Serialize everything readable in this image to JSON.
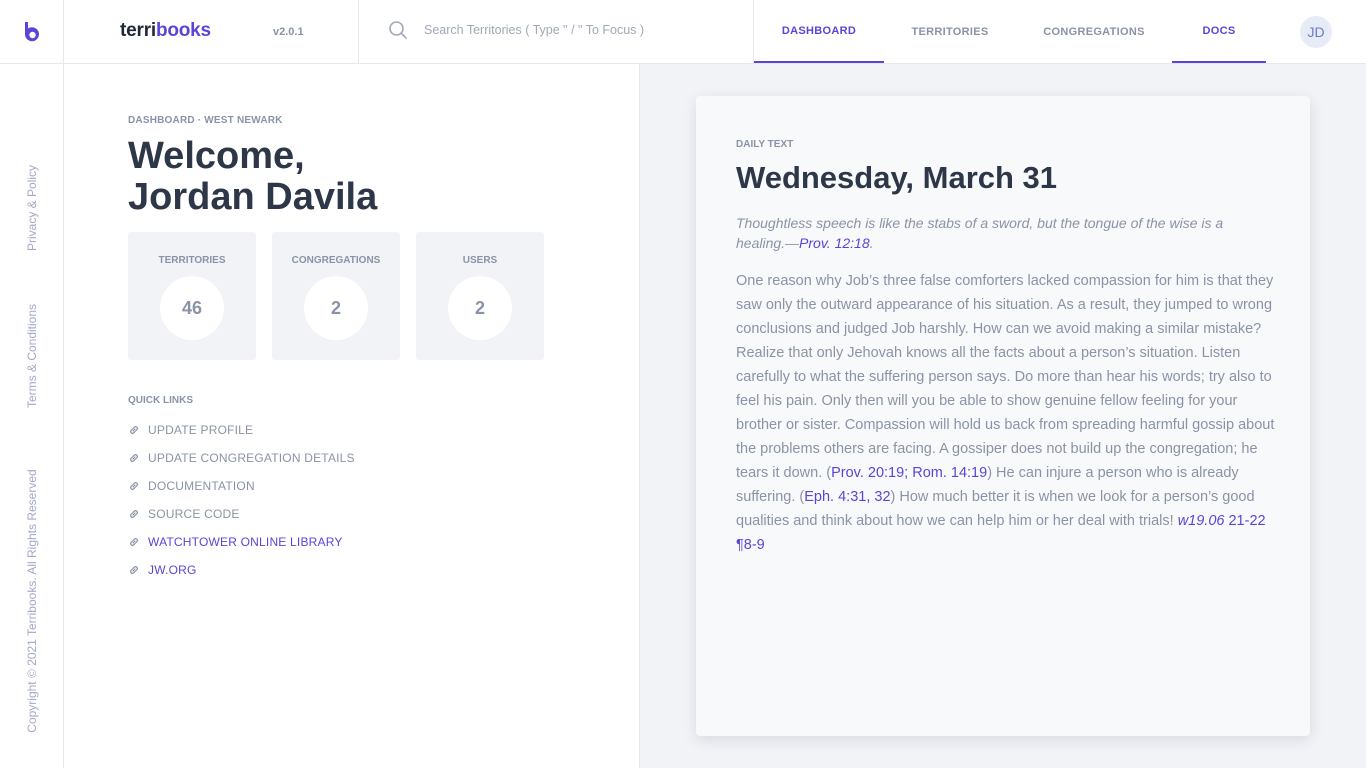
{
  "header": {
    "logo_letter": "b",
    "brand_part1": "terri",
    "brand_part2": "books",
    "version": "v2.0.1",
    "search_placeholder": "Search Territories  ( Type \" / \" To Focus )",
    "nav": [
      "DASHBOARD",
      "TERRITORIES",
      "CONGREGATIONS",
      "DOCS"
    ],
    "avatar_initials": "JD"
  },
  "sidebar": {
    "privacy": "Privacy & Policy",
    "terms": "Terms & Conditions",
    "copyright": "Copyright © 2021 Terribooks. All Rights Reserved"
  },
  "dashboard": {
    "breadcrumb": "DASHBOARD · WEST NEWARK",
    "welcome_line1": "Welcome,",
    "welcome_line2": "Jordan Davila",
    "stats": [
      {
        "label": "TERRITORIES",
        "value": "46"
      },
      {
        "label": "CONGREGATIONS",
        "value": "2"
      },
      {
        "label": "USERS",
        "value": "2"
      }
    ],
    "quick_links_title": "QUICK LINKS",
    "quick_links": [
      "UPDATE PROFILE",
      "UPDATE CONGREGATION DETAILS",
      "DOCUMENTATION",
      "SOURCE CODE",
      "WATCHTOWER ONLINE LIBRARY",
      "JW.ORG"
    ]
  },
  "daily_text": {
    "label": "DAILY TEXT",
    "date": "Wednesday, March 31",
    "quote": "Thoughtless speech is like the stabs of a sword, but the tongue of the wise is a healing.—",
    "quote_ref": "Prov. 12:18",
    "quote_end": ".",
    "body_1": "One reason why Job’s three false comforters lacked compassion for him is that they saw only the outward appearance of his situation. As a result, they jumped to wrong conclusions and judged Job harshly. How can we avoid making a similar mistake? Realize that only Jehovah knows all the facts about a person’s situation. Listen carefully to what the suffering person says. Do more than hear his words; try also to feel his pain. Only then will you be able to show genuine fellow feeling for your brother or sister. Compassion will hold us back from spreading harmful gossip about the problems others are facing. A gossiper does not build up the congregation; he tears it down. (",
    "ref_1": "Prov. 20:19; Rom. 14:19",
    "body_2": ") He can injure a person who is already suffering. (",
    "ref_2": "Eph. 4:31, 32",
    "body_3": ") How much better it is when we look for a person’s good qualities and think about how we can help him or her deal with trials! ",
    "ref_3_italic": "w19.06",
    "ref_3": " 21-22 ¶8-9"
  },
  "colors": {
    "accent": "#5b45d6",
    "muted": "#8a93a6",
    "panel_bg": "#f1f3f7"
  }
}
